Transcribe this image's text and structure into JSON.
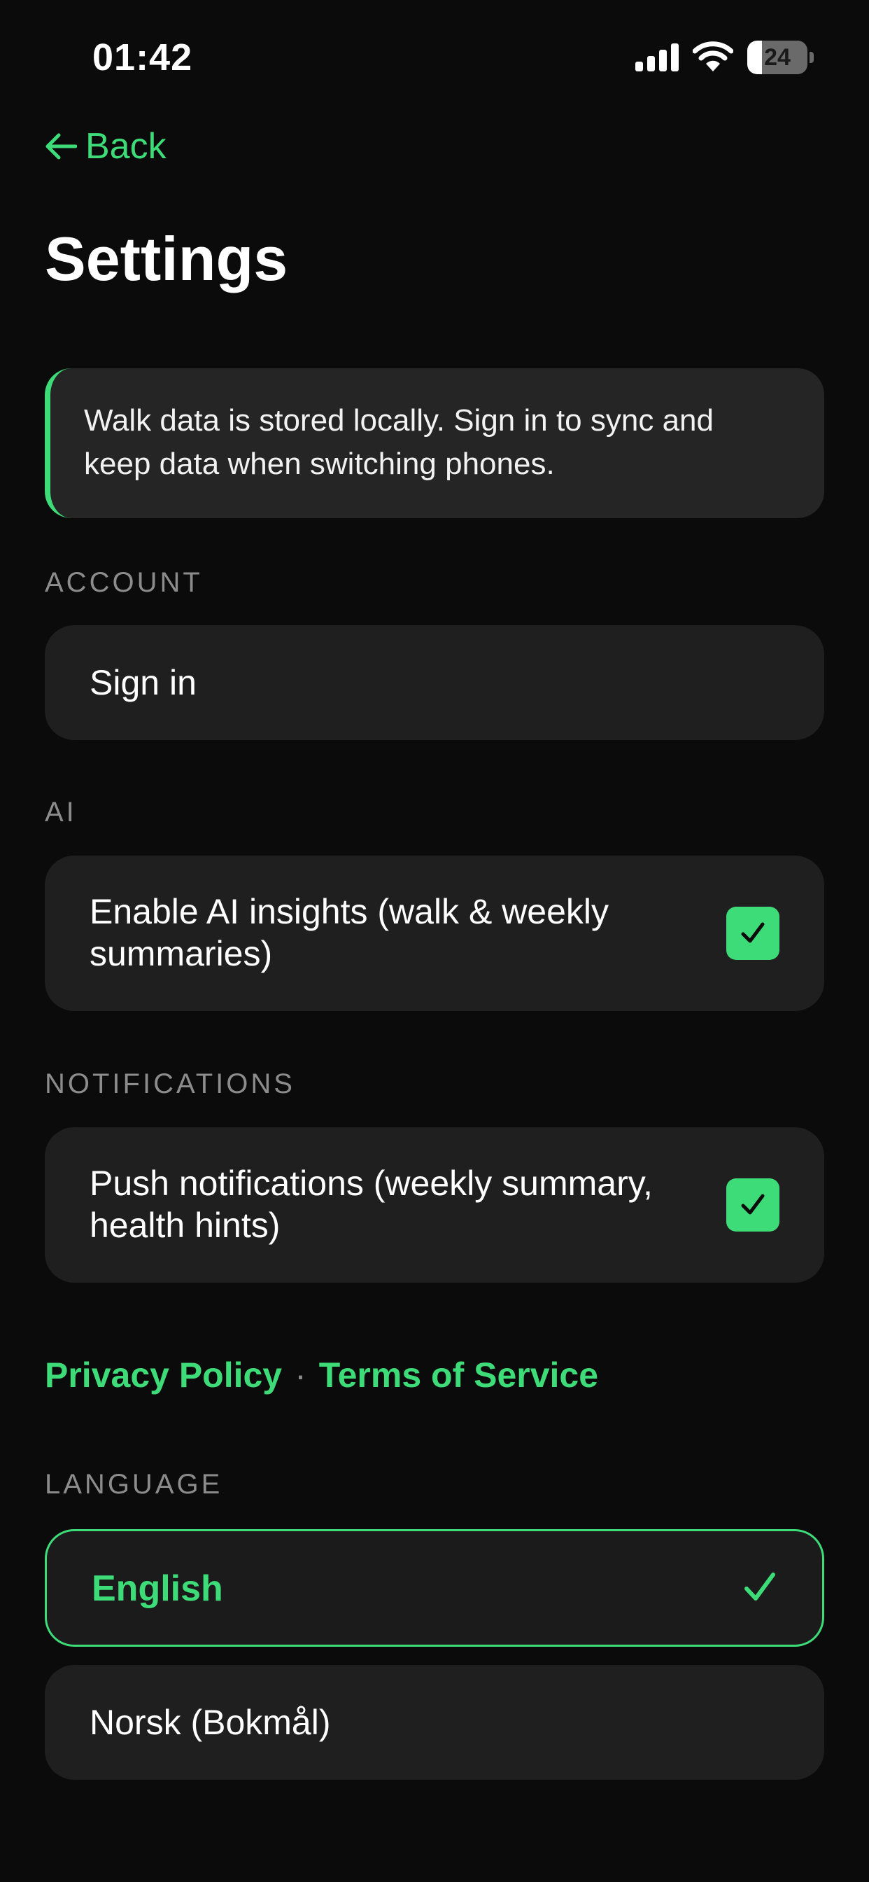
{
  "status_bar": {
    "time": "01:42",
    "battery_level": "24",
    "battery_fraction": 0.24,
    "icons": [
      "signal-icon",
      "wifi-icon",
      "battery-icon"
    ]
  },
  "nav": {
    "back_label": "Back",
    "back_icon": "arrow-left-icon"
  },
  "page": {
    "title": "Settings"
  },
  "banner": {
    "text": "Walk data is stored locally. Sign in to sync and keep data when switching phones."
  },
  "sections": {
    "account": {
      "label": "ACCOUNT",
      "sign_in_label": "Sign in"
    },
    "ai": {
      "label": "AI",
      "insights_label": "Enable AI insights (walk & weekly summaries)",
      "insights_checked": true
    },
    "notifications": {
      "label": "NOTIFICATIONS",
      "push_label": "Push notifications (weekly summary, health hints)",
      "push_checked": true
    },
    "legal": {
      "privacy_label": "Privacy Policy",
      "separator": "·",
      "terms_label": "Terms of Service"
    },
    "language": {
      "label": "LANGUAGE",
      "options": [
        {
          "label": "English",
          "selected": true
        },
        {
          "label": "Norsk (Bokmål)",
          "selected": false
        }
      ]
    }
  },
  "colors": {
    "background": "#0b0b0b",
    "card": "#1f1f1f",
    "accent": "#3ddc78",
    "muted_label": "#8c8c8c"
  }
}
